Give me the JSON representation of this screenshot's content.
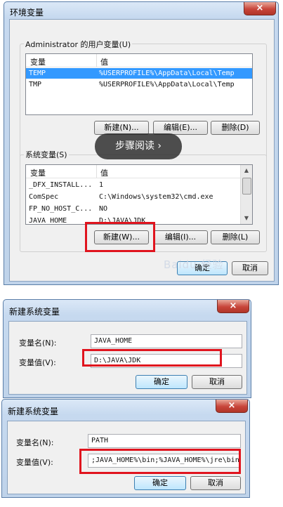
{
  "env_dialog": {
    "title": "环境变量",
    "close": "×",
    "user_group_label": "Administrator 的用户变量(U)",
    "columns": {
      "var": "变量",
      "value": "值"
    },
    "user_vars": [
      {
        "name": "TEMP",
        "value": "%USERPROFILE%\\AppData\\Local\\Temp"
      },
      {
        "name": "TMP",
        "value": "%USERPROFILE%\\AppData\\Local\\Temp"
      }
    ],
    "user_buttons": {
      "new": "新建(N)...",
      "edit": "编辑(E)...",
      "delete": "删除(D)"
    },
    "system_group_label": "系统变量(S)",
    "system_vars": [
      {
        "name": "_DFX_INSTALL...",
        "value": "1"
      },
      {
        "name": "ComSpec",
        "value": "C:\\Windows\\system32\\cmd.exe"
      },
      {
        "name": "FP_NO_HOST_C...",
        "value": "NO"
      },
      {
        "name": "JAVA_HOME",
        "value": "D:\\JAVA\\JDK"
      }
    ],
    "system_buttons": {
      "new": "新建(W)...",
      "edit": "编辑(I)...",
      "delete": "删除(L)"
    },
    "ok": "确定",
    "cancel": "取消"
  },
  "overlay": {
    "label": "步骤阅读 ›"
  },
  "watermark": {
    "text": "Baidu 经验"
  },
  "dialog1": {
    "title": "新建系统变量",
    "close": "×",
    "name_label": "变量名(N):",
    "value_label": "变量值(V):",
    "name_value": "JAVA_HOME",
    "value_value": "D:\\JAVA\\JDK",
    "ok": "确定",
    "cancel": "取消"
  },
  "dialog2": {
    "title": "新建系统变量",
    "close": "×",
    "name_label": "变量名(N):",
    "value_label": "变量值(V):",
    "name_value": "PATH",
    "value_value": ";JAVA_HOME%\\bin;%JAVA_HOME%\\jre\\bin;",
    "ok": "确定",
    "cancel": "取消"
  }
}
